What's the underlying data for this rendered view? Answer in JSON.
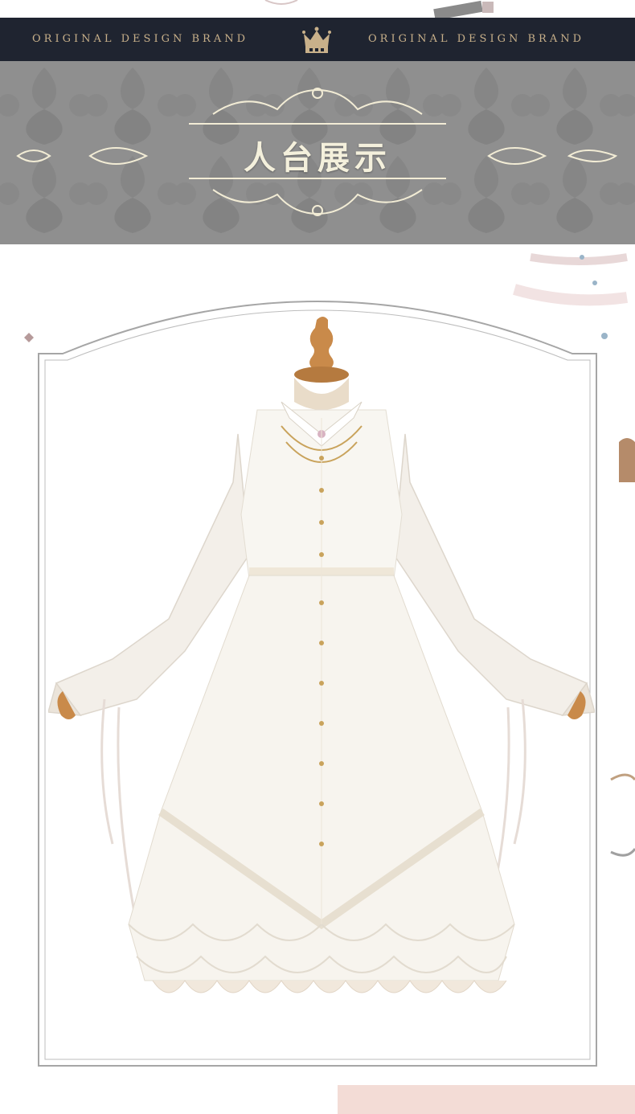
{
  "header": {
    "brand_left": "ORIGINAL DESIGN BRAND",
    "brand_right": "ORIGINAL DESIGN BRAND",
    "crown_icon": "crown-icon"
  },
  "banner": {
    "title": "人台展示"
  },
  "colors": {
    "topbar": "#1f2430",
    "brand_text": "#c8b08a",
    "damask": "#8f8f8f",
    "title": "#f4f0dc",
    "frame": "#9a9a9a",
    "dress": "#f7f4ee",
    "mannequin": "#c98a4a"
  },
  "photo": {
    "subject": "white-dress-on-mannequin"
  }
}
